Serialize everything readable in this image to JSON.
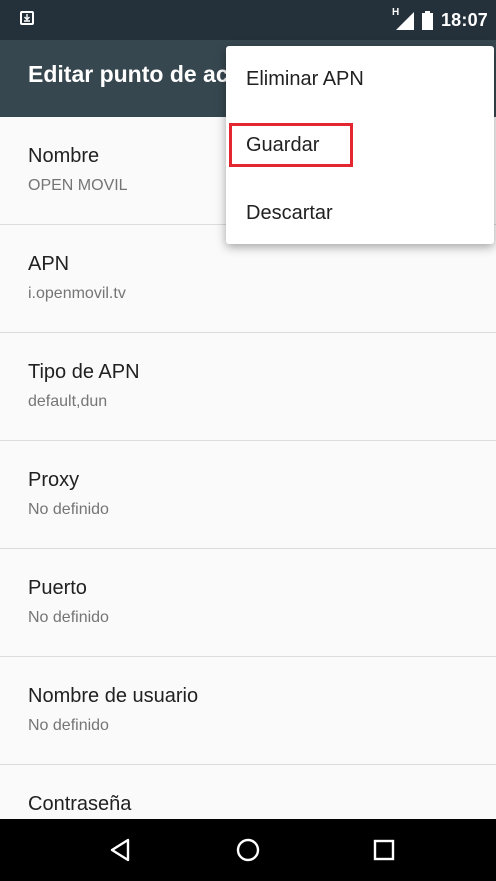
{
  "status_bar": {
    "time": "18:07",
    "signal_label": "H"
  },
  "app_bar": {
    "title": "Editar punto de acceso"
  },
  "menu": {
    "items": [
      {
        "label": "Eliminar APN"
      },
      {
        "label": "Guardar"
      },
      {
        "label": "Descartar"
      }
    ]
  },
  "fields": [
    {
      "title": "Nombre",
      "value": "OPEN MOVIL"
    },
    {
      "title": "APN",
      "value": "i.openmovil.tv"
    },
    {
      "title": "Tipo de APN",
      "value": "default,dun"
    },
    {
      "title": "Proxy",
      "value": "No definido"
    },
    {
      "title": "Puerto",
      "value": "No definido"
    },
    {
      "title": "Nombre de usuario",
      "value": "No definido"
    },
    {
      "title": "Contraseña",
      "value": ""
    }
  ],
  "colors": {
    "status_bar": "#24313a",
    "app_bar": "#37474f",
    "highlight": "#e3262f"
  },
  "icons": {
    "nav": [
      "back-icon",
      "home-icon",
      "recents-icon"
    ]
  }
}
